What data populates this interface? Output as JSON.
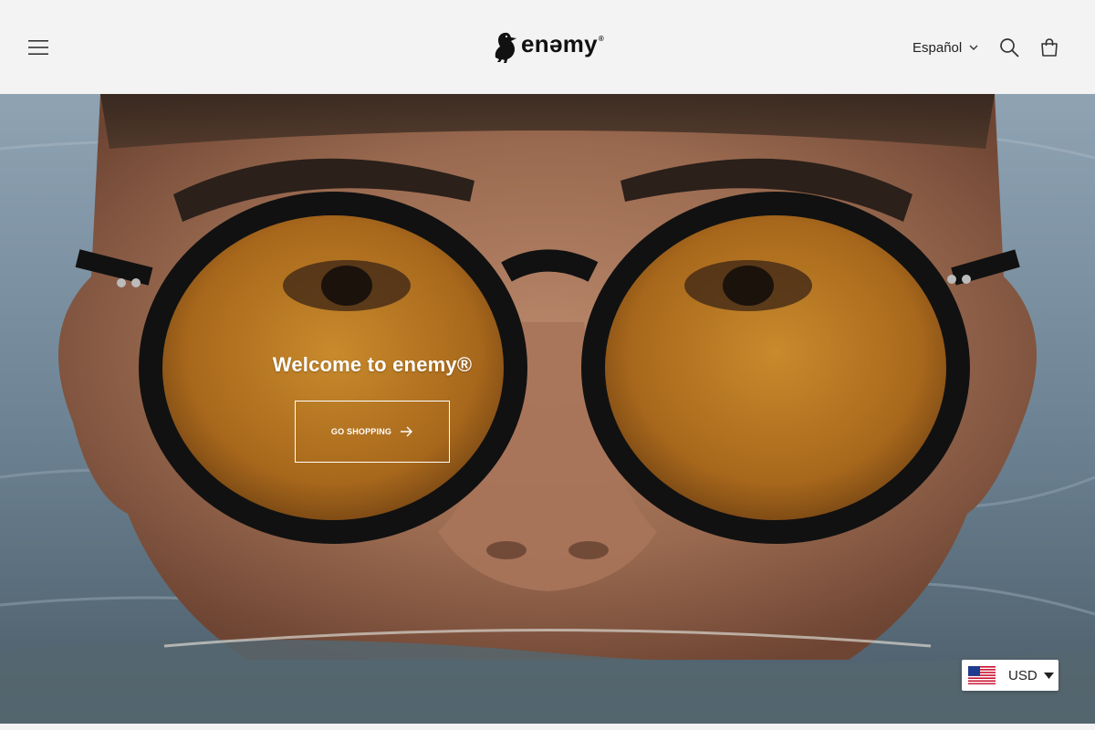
{
  "header": {
    "logo_text": "enəmy",
    "logo_mark": "®",
    "language": "Español"
  },
  "hero": {
    "title": "Welcome to enemy®",
    "cta_label": "GO SHOPPING"
  },
  "currency": {
    "code": "USD",
    "flag": "us-flag-icon"
  },
  "icons": {
    "menu": "menu-icon",
    "search": "search-icon",
    "cart": "shopping-bag-icon",
    "lang_caret": "chevron-down-icon",
    "cta_arrow": "arrow-right-icon"
  }
}
